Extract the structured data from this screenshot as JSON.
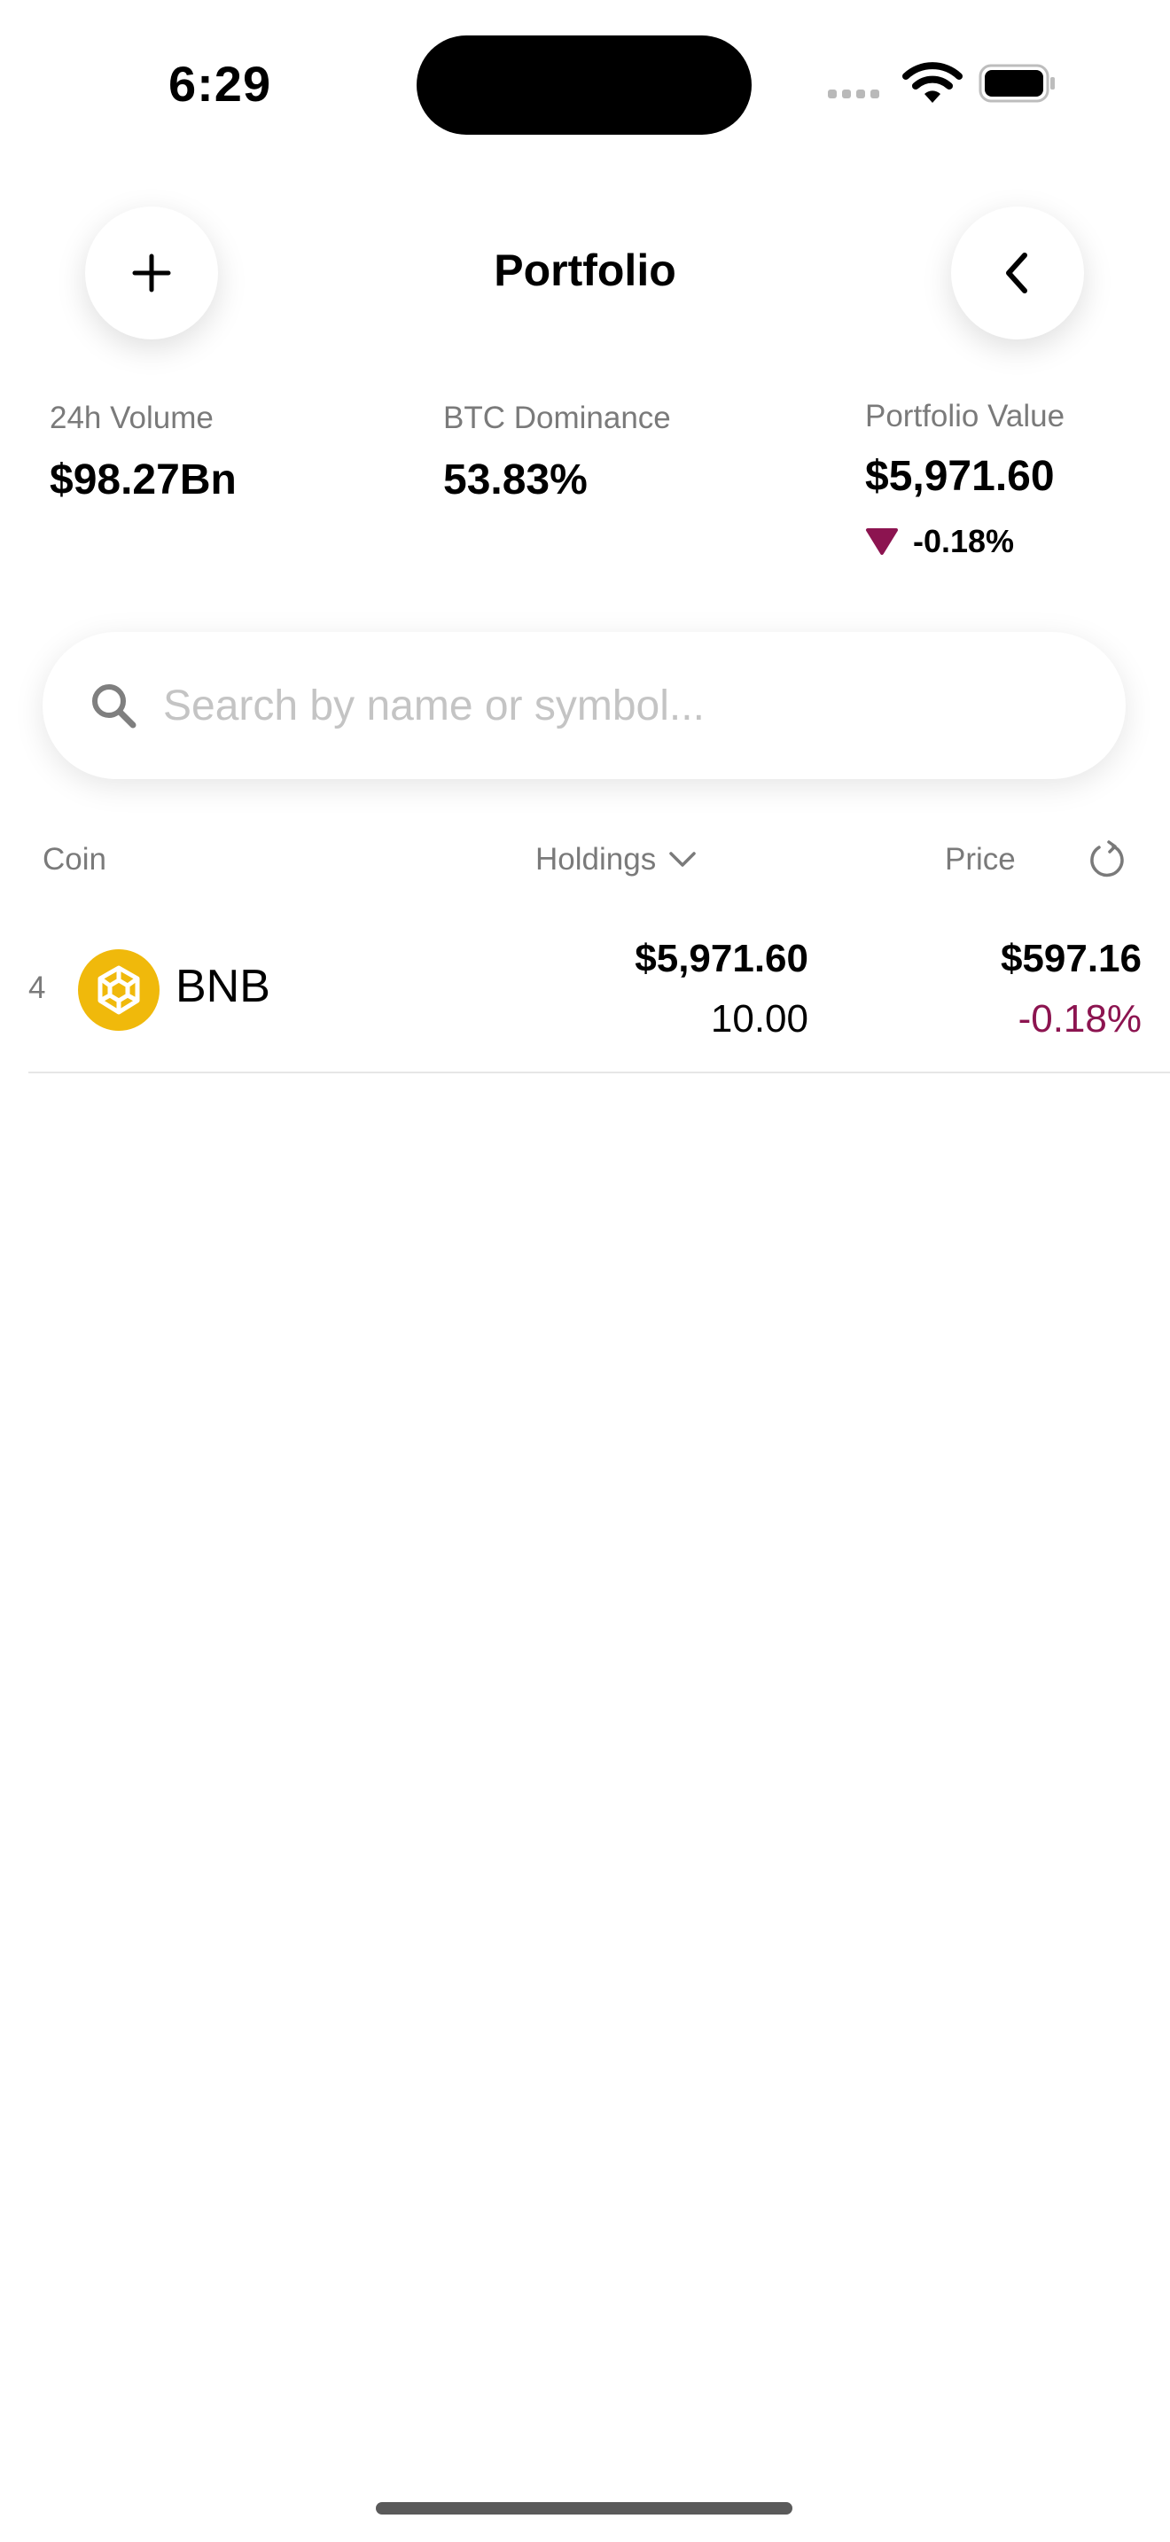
{
  "status_bar": {
    "time": "6:29"
  },
  "header": {
    "title": "Portfolio"
  },
  "stats": {
    "volume": {
      "label": "24h Volume",
      "value": "$98.27Bn"
    },
    "dominance": {
      "label": "BTC Dominance",
      "value": "53.83%"
    },
    "portfolio": {
      "label": "Portfolio Value",
      "value": "$5,971.60",
      "change": "-0.18%",
      "direction": "down"
    }
  },
  "search": {
    "placeholder": "Search by name or symbol..."
  },
  "columns": {
    "coin": "Coin",
    "holdings": "Holdings",
    "price": "Price"
  },
  "rows": [
    {
      "rank": "4",
      "symbol": "BNB",
      "holdings_value": "$5,971.60",
      "holdings_qty": "10.00",
      "price": "$597.16",
      "change": "-0.18%"
    }
  ],
  "colors": {
    "negative": "#8c1450",
    "bnb_brand": "#f0b90b"
  },
  "icons": [
    "plus-icon",
    "chevron-left-icon",
    "search-icon",
    "chevron-down-icon",
    "refresh-icon",
    "bnb-logo-icon",
    "down-triangle-icon",
    "wifi-icon",
    "battery-icon"
  ]
}
